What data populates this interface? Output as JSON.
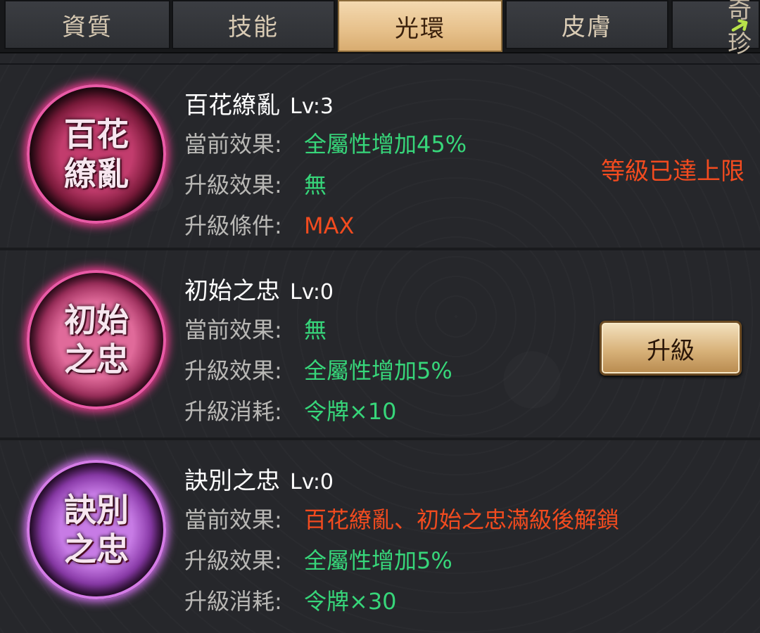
{
  "tabs": [
    {
      "label": "資質",
      "active": false
    },
    {
      "label": "技能",
      "active": false
    },
    {
      "label": "光環",
      "active": true
    },
    {
      "label": "皮膚",
      "active": false
    },
    {
      "label": "奇珍",
      "active": false
    }
  ],
  "labels": {
    "current": "當前效果:",
    "upgrade_effect": "升級效果:",
    "upgrade_condition": "升級條件:",
    "upgrade_cost": "升級消耗:"
  },
  "auras": [
    {
      "emblem": "百花繚亂",
      "name": "百花繚亂",
      "level": "Lv:3",
      "current": "全屬性增加45%",
      "upgrade_effect": "無",
      "third_value": "MAX",
      "status": "等級已達上限"
    },
    {
      "emblem": "初始之忠",
      "name": "初始之忠",
      "level": "Lv:0",
      "current": "無",
      "upgrade_effect": "全屬性增加5%",
      "third_value": "令牌×10",
      "button": "升級"
    },
    {
      "emblem": "訣別之忠",
      "name": "訣別之忠",
      "level": "Lv:0",
      "current": "百花繚亂、初始之忠滿級後解鎖",
      "upgrade_effect": "全屬性增加5%",
      "third_value": "令牌×30"
    }
  ],
  "colors": {
    "green": "#37d67a",
    "red": "#f24b1f",
    "tab_active": "#e6c08a"
  },
  "icons": {
    "next-tab": "arrow-icon"
  }
}
